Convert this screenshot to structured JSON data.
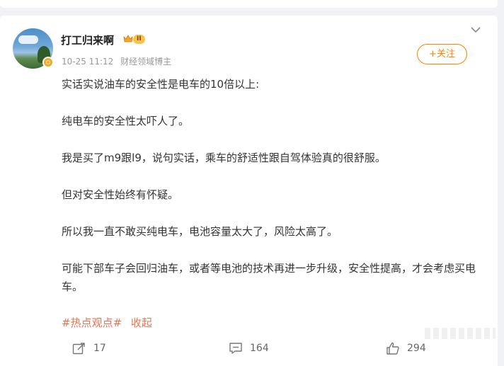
{
  "post": {
    "author": {
      "name": "打工归来啊",
      "level_label": "II",
      "avatar_icon": "avatar-landscape-icon",
      "verified_icon": "verified-badge-icon"
    },
    "meta": {
      "timestamp": "10-25 11:12",
      "role": "财经领域博主"
    },
    "follow_label": "+关注",
    "paragraphs": [
      "实话实说油车的安全性是电车的10倍以上:",
      "纯电车的安全性太吓人了。",
      "我是买了m9跟l9，说句实话，乘车的舒适性跟自驾体验真的很舒服。",
      "但对安全性始终有怀疑。",
      "所以我一直不敢买纯电车，电池容量太大了，风险太高了。",
      "可能下部车子会回归油车，或者等电池的技术再进一步升级，安全性提高，才会考虑买电车。"
    ],
    "hashtag": "#热点观点#",
    "collapse_label": "收起",
    "actions": {
      "repost_count": "17",
      "comment_count": "164",
      "like_count": "294"
    }
  },
  "colors": {
    "accent_orange": "#ff8200",
    "link_orange": "#eb7350",
    "text_main": "#333333",
    "text_meta": "#999999",
    "page_bg": "#f1f2f5"
  }
}
